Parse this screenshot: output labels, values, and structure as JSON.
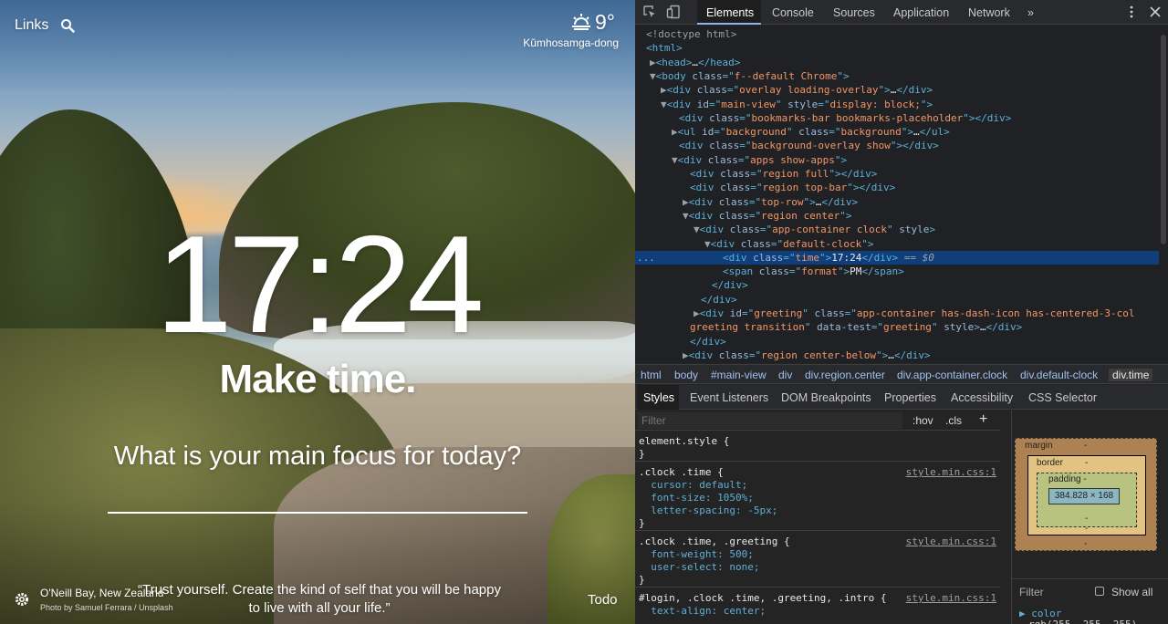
{
  "momentum": {
    "links_label": "Links",
    "weather": {
      "temperature": "9°",
      "location": "Kŭmhosamga-dong"
    },
    "clock": "17:24",
    "greeting": "Make time.",
    "focus_question": "What is your main focus for today?",
    "photo": {
      "location": "O'Neill Bay, New Zealand",
      "credit": "Photo by Samuel Ferrara / Unsplash"
    },
    "quote": "“Trust yourself. Create the kind of self that you will be happy to live with all your life.”",
    "todo_label": "Todo"
  },
  "devtools": {
    "tabs": [
      "Elements",
      "Console",
      "Sources",
      "Application",
      "Network",
      "»"
    ],
    "dom_lines": [
      {
        "segs": [
          [
            "tw",
            "<!doctype html>"
          ]
        ]
      },
      {
        "segs": [
          [
            "tg",
            "<html>"
          ]
        ]
      },
      {
        "segs": [
          [
            "tw",
            "▶"
          ],
          [
            "tg",
            "<head>"
          ],
          [
            "tx",
            "…"
          ],
          [
            "tg",
            "</head>"
          ]
        ]
      },
      {
        "segs": [
          [
            "tw",
            "▼"
          ],
          [
            "tg",
            "<body "
          ],
          [
            "an",
            "class"
          ],
          [
            "tg",
            "=\""
          ],
          [
            "av",
            "f--default Chrome"
          ],
          [
            "tg",
            "\">"
          ]
        ]
      },
      {
        "segs": [
          [
            "tw",
            "▶"
          ],
          [
            "tg",
            "<div "
          ],
          [
            "an",
            "class"
          ],
          [
            "tg",
            "=\""
          ],
          [
            "av",
            "overlay loading-overlay"
          ],
          [
            "tg",
            "\">"
          ],
          [
            "tx",
            "…"
          ],
          [
            "tg",
            "</div>"
          ]
        ]
      },
      {
        "segs": [
          [
            "tw",
            "▼"
          ],
          [
            "tg",
            "<div "
          ],
          [
            "an",
            "id"
          ],
          [
            "tg",
            "=\""
          ],
          [
            "av",
            "main-view"
          ],
          [
            "tg",
            "\" "
          ],
          [
            "an",
            "style"
          ],
          [
            "tg",
            "=\""
          ],
          [
            "av",
            "display: block;"
          ],
          [
            "tg",
            "\">"
          ]
        ]
      },
      {
        "segs": [
          [
            "tg",
            "<div "
          ],
          [
            "an",
            "class"
          ],
          [
            "tg",
            "=\""
          ],
          [
            "av",
            "bookmarks-bar bookmarks-placeholder"
          ],
          [
            "tg",
            "\"></div>"
          ]
        ]
      },
      {
        "segs": [
          [
            "tw",
            "▶"
          ],
          [
            "tg",
            "<ul "
          ],
          [
            "an",
            "id"
          ],
          [
            "tg",
            "=\""
          ],
          [
            "av",
            "background"
          ],
          [
            "tg",
            "\" "
          ],
          [
            "an",
            "class"
          ],
          [
            "tg",
            "=\""
          ],
          [
            "av",
            "background"
          ],
          [
            "tg",
            "\">"
          ],
          [
            "tx",
            "…"
          ],
          [
            "tg",
            "</ul>"
          ]
        ]
      },
      {
        "segs": [
          [
            "tg",
            "<div "
          ],
          [
            "an",
            "class"
          ],
          [
            "tg",
            "=\""
          ],
          [
            "av",
            "background-overlay show"
          ],
          [
            "tg",
            "\"></div>"
          ]
        ]
      },
      {
        "segs": [
          [
            "tw",
            "▼"
          ],
          [
            "tg",
            "<div "
          ],
          [
            "an",
            "class"
          ],
          [
            "tg",
            "=\""
          ],
          [
            "av",
            "apps show-apps"
          ],
          [
            "tg",
            "\">"
          ]
        ]
      },
      {
        "segs": [
          [
            "tg",
            "<div "
          ],
          [
            "an",
            "class"
          ],
          [
            "tg",
            "=\""
          ],
          [
            "av",
            "region full"
          ],
          [
            "tg",
            "\"></div>"
          ]
        ]
      },
      {
        "segs": [
          [
            "tg",
            "<div "
          ],
          [
            "an",
            "class"
          ],
          [
            "tg",
            "=\""
          ],
          [
            "av",
            "region top-bar"
          ],
          [
            "tg",
            "\"></div>"
          ]
        ]
      },
      {
        "segs": [
          [
            "tw",
            "▶"
          ],
          [
            "tg",
            "<div "
          ],
          [
            "an",
            "class"
          ],
          [
            "tg",
            "=\""
          ],
          [
            "av",
            "top-row"
          ],
          [
            "tg",
            "\">"
          ],
          [
            "tx",
            "…"
          ],
          [
            "tg",
            "</div>"
          ]
        ]
      },
      {
        "segs": [
          [
            "tw",
            "▼"
          ],
          [
            "tg",
            "<div "
          ],
          [
            "an",
            "class"
          ],
          [
            "tg",
            "=\""
          ],
          [
            "av",
            "region center"
          ],
          [
            "tg",
            "\">"
          ]
        ]
      },
      {
        "segs": [
          [
            "tw",
            "▼"
          ],
          [
            "tg",
            "<div "
          ],
          [
            "an",
            "class"
          ],
          [
            "tg",
            "=\""
          ],
          [
            "av",
            "app-container clock"
          ],
          [
            "tg",
            "\" "
          ],
          [
            "an",
            "style"
          ],
          [
            "tg",
            ">"
          ]
        ]
      },
      {
        "segs": [
          [
            "tw",
            "▼"
          ],
          [
            "tg",
            "<div "
          ],
          [
            "an",
            "class"
          ],
          [
            "tg",
            "=\""
          ],
          [
            "av",
            "default-clock"
          ],
          [
            "tg",
            "\">"
          ]
        ]
      },
      {
        "segs": [
          [
            "tg",
            "<div "
          ],
          [
            "an",
            "class"
          ],
          [
            "tg",
            "=\""
          ],
          [
            "av",
            "time"
          ],
          [
            "tg",
            "\">"
          ],
          [
            "tx",
            "17:24"
          ],
          [
            "tg",
            "</div>"
          ],
          [
            "tw",
            " == "
          ],
          [
            "dm",
            "$0"
          ]
        ]
      },
      {
        "segs": [
          [
            "tg",
            "<span "
          ],
          [
            "an",
            "class"
          ],
          [
            "tg",
            "=\""
          ],
          [
            "av",
            "format"
          ],
          [
            "tg",
            "\">"
          ],
          [
            "tx",
            "PM"
          ],
          [
            "tg",
            "</span>"
          ]
        ]
      },
      {
        "segs": [
          [
            "tg",
            "</div>"
          ]
        ]
      },
      {
        "segs": [
          [
            "tg",
            "</div>"
          ]
        ]
      },
      {
        "segs": [
          [
            "tw",
            "▶"
          ],
          [
            "tg",
            "<div "
          ],
          [
            "an",
            "id"
          ],
          [
            "tg",
            "=\""
          ],
          [
            "av",
            "greeting"
          ],
          [
            "tg",
            "\" "
          ],
          [
            "an",
            "class"
          ],
          [
            "tg",
            "=\""
          ],
          [
            "av",
            "app-container has-dash-icon has-centered-3-col"
          ]
        ]
      },
      {
        "segs": [
          [
            "av",
            "greeting transition"
          ],
          [
            "tg",
            "\" "
          ],
          [
            "an",
            "data-test"
          ],
          [
            "tg",
            "=\""
          ],
          [
            "av",
            "greeting"
          ],
          [
            "tg",
            "\" "
          ],
          [
            "an",
            "style"
          ],
          [
            "tg",
            ">"
          ],
          [
            "tx",
            "…"
          ],
          [
            "tg",
            "</div>"
          ]
        ]
      },
      {
        "segs": [
          [
            "tg",
            "</div>"
          ]
        ]
      },
      {
        "segs": [
          [
            "tw",
            "▶"
          ],
          [
            "tg",
            "<div "
          ],
          [
            "an",
            "class"
          ],
          [
            "tg",
            "=\""
          ],
          [
            "av",
            "region center-below"
          ],
          [
            "tg",
            "\">"
          ],
          [
            "tx",
            "…"
          ],
          [
            "tg",
            "</div>"
          ]
        ]
      }
    ],
    "selected_line_marker": "...",
    "breadcrumbs": [
      "html",
      "body",
      "#main-view",
      "div",
      "div.region.center",
      "div.app-container.clock",
      "div.default-clock",
      "div.time"
    ],
    "sub_tabs": [
      "Styles",
      "Event Listeners",
      "DOM Breakpoints",
      "Properties",
      "Accessibility",
      "CSS Selector"
    ],
    "filter_placeholder": "Filter",
    "hov": ":hov",
    "cls": ".cls",
    "style_lines": [
      {
        "t": "element.style {",
        "src": ""
      },
      {
        "t": "}",
        "src": ""
      },
      {
        "t": ".clock .time {",
        "src": "style.min.css:1"
      },
      {
        "t": "  cursor: default;",
        "src": ""
      },
      {
        "t": "  font-size: 1050%;",
        "src": ""
      },
      {
        "t": "  letter-spacing: -5px;",
        "src": ""
      },
      {
        "t": "}",
        "src": ""
      },
      {
        "t": ".clock .time, .greeting {",
        "src": "style.min.css:1"
      },
      {
        "t": "  font-weight: 500;",
        "src": ""
      },
      {
        "t": "  user-select: none;",
        "src": ""
      },
      {
        "t": "}",
        "src": ""
      },
      {
        "t": "#login, .clock .time, .greeting, .intro {",
        "src": "style.min.css:1"
      },
      {
        "t": "  text-align: center;",
        "src": ""
      }
    ],
    "box_model": {
      "margin": "margin",
      "border": "border",
      "padding": "padding -",
      "content": "384.828 × 168",
      "dash": "-"
    },
    "computed_filter": "Filter",
    "show_all": "Show all",
    "color_prop": "▶ color",
    "color_val": "rgb(255, 255, 255)"
  }
}
